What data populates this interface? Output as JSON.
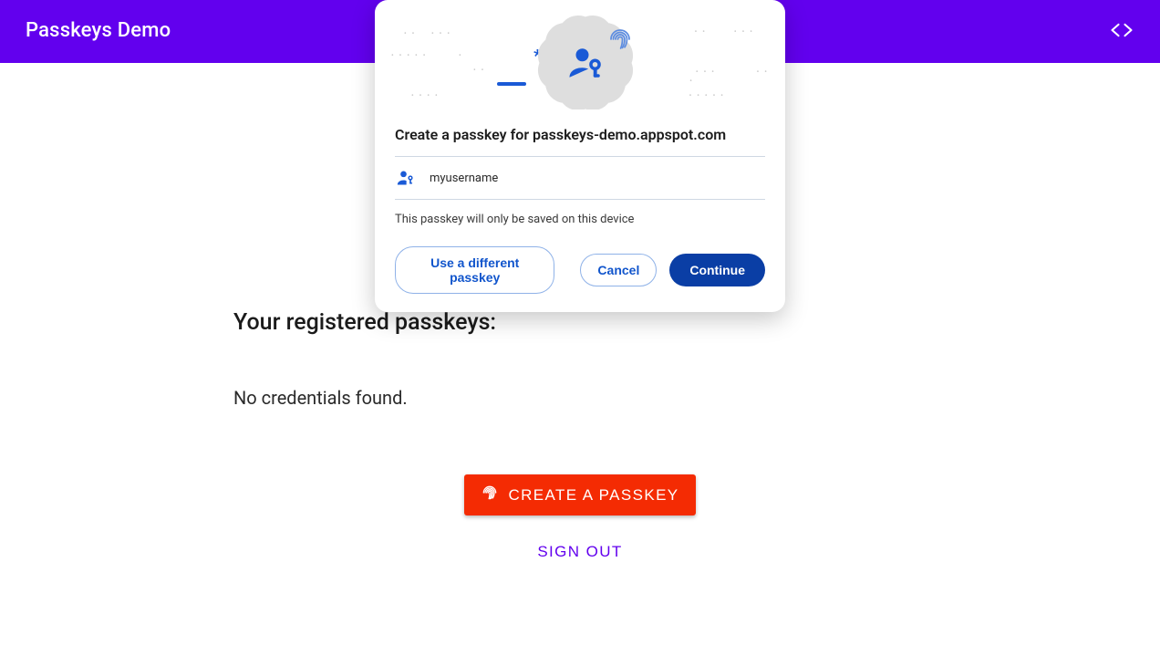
{
  "header": {
    "title": "Passkeys Demo"
  },
  "main": {
    "section_title": "Your registered passkeys:",
    "empty_text": "No credentials found.",
    "create_button": "CREATE A PASSKEY",
    "signout_button": "SIGN OUT"
  },
  "dialog": {
    "title": "Create a passkey for passkeys-demo.appspot.com",
    "username": "myusername",
    "note": "This passkey will only be saved on this device",
    "use_different": "Use a different passkey",
    "cancel": "Cancel",
    "continue": "Continue"
  },
  "icons": {
    "code": "code-icon",
    "fingerprint": "fingerprint-icon",
    "passkey_person": "passkey-person-icon"
  },
  "colors": {
    "brand": "#6200ee",
    "danger": "#f42b03",
    "dialog_blue": "#0a3ea5",
    "link_blue": "#1155cc"
  }
}
